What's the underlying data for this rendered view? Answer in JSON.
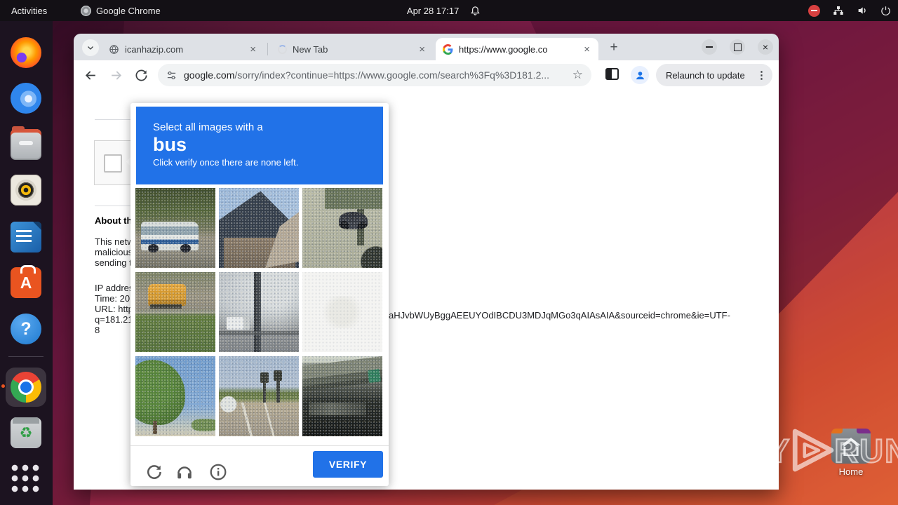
{
  "topbar": {
    "activities_label": "Activities",
    "focused_app": "Google Chrome",
    "clock": "Apr 28 17:17"
  },
  "dock": {
    "items": [
      {
        "name": "firefox",
        "title": "Firefox"
      },
      {
        "name": "thunderbird",
        "title": "Thunderbird Mail"
      },
      {
        "name": "files",
        "title": "Files"
      },
      {
        "name": "rhythmbox",
        "title": "Rhythmbox"
      },
      {
        "name": "libreoffice-writer",
        "title": "LibreOffice Writer"
      },
      {
        "name": "ubuntu-software",
        "title": "Ubuntu Software"
      },
      {
        "name": "help",
        "title": "Help"
      },
      {
        "name": "chrome",
        "title": "Google Chrome"
      },
      {
        "name": "trash",
        "title": "Trash"
      },
      {
        "name": "app-grid",
        "title": "Show Applications"
      }
    ],
    "software_glyph": "A",
    "help_glyph": "?",
    "trash_glyph": "♻"
  },
  "browser": {
    "tabs": [
      {
        "title": "icanhazip.com"
      },
      {
        "title": "New Tab"
      },
      {
        "title": "https://www.google.co"
      }
    ],
    "close_glyph": "×",
    "new_tab_glyph": "+",
    "address_host": "google.com",
    "address_path": "/sorry/index?continue=https://www.google.com/search%3Fq%3D181.2...",
    "bookmark_glyph": "☆",
    "relaunch_label": "Relaunch to update",
    "kebab_glyph": "⋮"
  },
  "page": {
    "about_heading": "About th",
    "para_line1": "This netw",
    "para_line2": "malicious",
    "para_line3": "sending t",
    "info_line1": "IP addres",
    "info_line2": "Time: 20",
    "info_line3": "URL: http",
    "info_line4": "q=181.21",
    "info_line5": "8",
    "wrapped_url_fragment": "aHJvbWUyBggAEEUYOdIBCDU3MDJqMGo3qAIAsAIA&sourceid=chrome&ie=UTF-"
  },
  "captcha": {
    "instruction": "Select all images with a",
    "target": "bus",
    "subtext": "Click verify once there are none left.",
    "verify_label": "VERIFY",
    "header_color": "#2172e8",
    "tiles": [
      {
        "desc": "white city bus on street under trees"
      },
      {
        "desc": "dark roof of house against blue sky"
      },
      {
        "desc": "motorcycle parked on grainy street"
      },
      {
        "desc": "yellow school bus on road behind green field"
      },
      {
        "desc": "utility pole with box truck and cloudy sky"
      },
      {
        "desc": "washed-out white tile"
      },
      {
        "desc": "leafy green tree against blue sky"
      },
      {
        "desc": "road with traffic lights and cars"
      },
      {
        "desc": "highway overpass with green sign"
      }
    ]
  },
  "desktop": {
    "watermark_left": "ANY",
    "watermark_right": "RUN",
    "home_icon_label": "Home"
  }
}
